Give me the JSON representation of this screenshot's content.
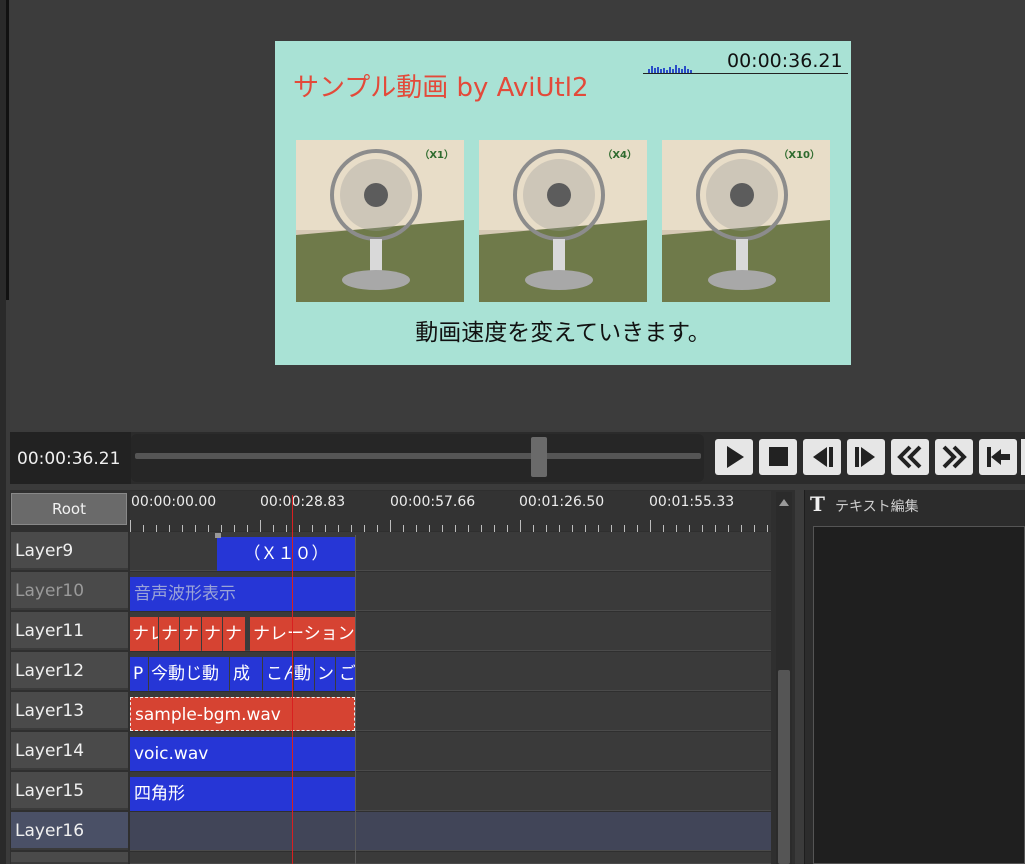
{
  "preview": {
    "title": "サンプル動画 by AviUtl2",
    "timecode": "00:00:36.21",
    "caption": "動画速度を変えていきます。",
    "thumbnails": [
      {
        "label": "（X1）"
      },
      {
        "label": "（X4）"
      },
      {
        "label": "（X10）"
      }
    ]
  },
  "transport": {
    "current_time": "00:00:36.21",
    "seek_position": 0.72,
    "buttons": [
      "play-icon",
      "stop-icon",
      "step-back-icon",
      "step-forward-icon",
      "rewind-icon",
      "fast-forward-icon",
      "jump-start-icon"
    ]
  },
  "timeline": {
    "root_label": "Root",
    "ruler_labels": [
      "00:00:00.00",
      "00:00:28.83",
      "00:00:57.66",
      "00:01:26.50",
      "00:01:55.33"
    ],
    "layers": [
      {
        "name": "Layer9",
        "clips": [
          {
            "text": "（Ｘ１０）",
            "color": "blue"
          }
        ]
      },
      {
        "name": "Layer10",
        "dim": true,
        "clips": [
          {
            "text": "音声波形表示",
            "color": "blue"
          }
        ]
      },
      {
        "name": "Layer11",
        "clips": [
          {
            "text": "ナレ",
            "color": "red"
          },
          {
            "text": "ナ",
            "color": "red"
          },
          {
            "text": "ナ",
            "color": "red"
          },
          {
            "text": "ナ",
            "color": "red"
          },
          {
            "text": "ナ",
            "color": "red"
          },
          {
            "text": "ナレーションせ",
            "color": "red"
          }
        ]
      },
      {
        "name": "Layer12",
        "clips": [
          {
            "text": "P",
            "color": "blue"
          },
          {
            "text": "今動じ動",
            "color": "blue"
          },
          {
            "text": "成",
            "color": "blue"
          },
          {
            "text": "こん",
            "color": "blue"
          },
          {
            "text": "動",
            "color": "blue"
          },
          {
            "text": "ン",
            "color": "blue"
          },
          {
            "text": "ご",
            "color": "blue"
          }
        ]
      },
      {
        "name": "Layer13",
        "clips": [
          {
            "text": "sample-bgm.wav",
            "color": "red"
          }
        ]
      },
      {
        "name": "Layer14",
        "clips": [
          {
            "text": "voic.wav",
            "color": "blue"
          }
        ]
      },
      {
        "name": "Layer15",
        "clips": [
          {
            "text": "四角形",
            "color": "blue"
          }
        ]
      },
      {
        "name": "Layer16",
        "selected": true,
        "clips": []
      }
    ]
  },
  "text_panel": {
    "title": "テキスト編集",
    "icon": "T"
  },
  "colors": {
    "frame_bg": "#a9e2d5",
    "title_red": "#e34a3a",
    "clip_blue": "#2636d6",
    "clip_red": "#d64332",
    "playhead": "#d82020"
  }
}
